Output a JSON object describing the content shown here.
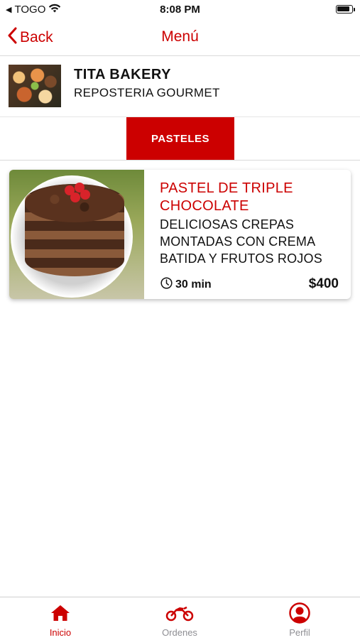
{
  "status_bar": {
    "carrier": "TOGO",
    "time": "8:08 PM"
  },
  "nav": {
    "back_label": "Back",
    "title": "Menú"
  },
  "store": {
    "name": "TITA BAKERY",
    "subtitle": "REPOSTERIA GOURMET"
  },
  "category_tabs": [
    {
      "label": "PASTELES",
      "active": true
    }
  ],
  "products": [
    {
      "name": "PASTEL DE TRIPLE CHOCOLATE",
      "description": "DELICIOSAS CREPAS MONTADAS CON CREMA BATIDA Y FRUTOS ROJOS",
      "time": "30 min",
      "price": "$400"
    }
  ],
  "bottom_tabs": [
    {
      "label": "Inicio",
      "icon": "home-icon",
      "active": true
    },
    {
      "label": "Ordenes",
      "icon": "motorcycle-icon",
      "active": false
    },
    {
      "label": "Perfil",
      "icon": "user-circle-icon",
      "active": false
    }
  ],
  "colors": {
    "accent": "#cc0000",
    "inactive_tab": "#8e8e93",
    "text": "#111111"
  }
}
